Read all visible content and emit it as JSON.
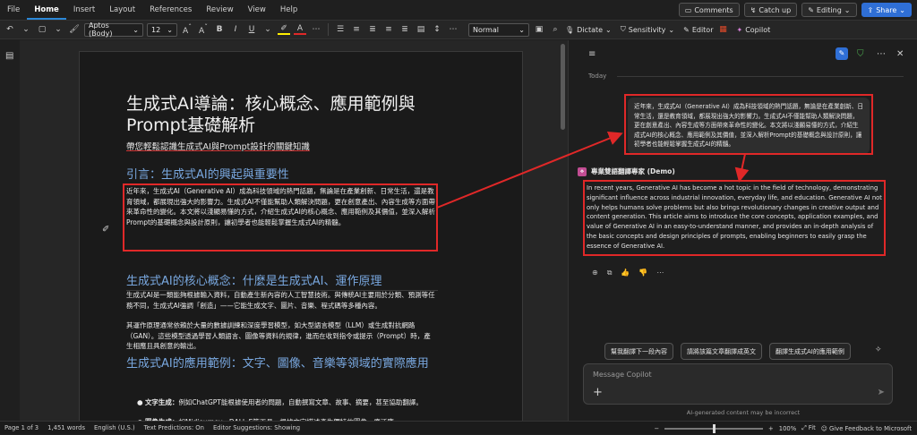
{
  "menu": {
    "items": [
      "File",
      "Home",
      "Insert",
      "Layout",
      "References",
      "Review",
      "View",
      "Help"
    ],
    "active": "Home",
    "comments": "Comments",
    "catch_up": "Catch up",
    "editing": "Editing",
    "share": "Share"
  },
  "ribbon": {
    "font": "Aptos (Body)",
    "size": "12",
    "style": "Normal",
    "dictate": "Dictate",
    "sensitivity": "Sensitivity",
    "editor": "Editor",
    "copilot": "Copilot"
  },
  "doc": {
    "title": "生成式AI導論：核心概念、應用範例與Prompt基礎解析",
    "subtitle": "帶您輕鬆認識生成式AI與Prompt設計的關鍵知識",
    "intro_heading": "引言：生成式AI的興起與重要性",
    "intro_para": "近年來，生成式AI（Generative AI）成為科技領域的熱門話題，無論是在產業創新、日常生活，還是教育領域，都展現出強大的影響力。生成式AI不僅能幫助人類解決問題，更在創意產出、內容生成等方面帶來革命性的變化。本文將以淺顯易懂的方式，介紹生成式AI的核心概念、應用範例及其價值，並深入解析Prompt的基礎概念與設計原則，讓初學者也能輕鬆掌握生成式AI的精髓。",
    "core_heading": "生成式AI的核心概念：什麼是生成式AI、運作原理",
    "core_para1": "生成式AI是一類能夠根據輸入資料，自動產生新內容的人工智慧技術。與傳統AI主要用於分類、預測等任務不同，生成式AI強調「創造」——它能生成文字、圖片、音樂、程式碼等多種內容。",
    "core_para2": "其運作原理通常依賴於大量的數據訓練和深度學習模型，如大型語言模型（LLM）或生成對抗網路（GAN）。這些模型透過學習人類語言、圖像等資料的規律，進而在收到指令或提示（Prompt）時，產生相應且具創意的輸出。",
    "app_heading": "生成式AI的應用範例：文字、圖像、音樂等領域的實際應用",
    "bullets": [
      {
        "label": "文字生成：",
        "text": "例如ChatGPT能根據使用者的問題，自動撰寫文章、故事、摘要，甚至協助翻譯。"
      },
      {
        "label": "圖像生成：",
        "text": "如Midjourney、DALL-E等工具，根據文字描述產生獨特的圖像，廣泛應"
      }
    ]
  },
  "copilot": {
    "today": "Today",
    "user_msg": "近年來，生成式AI（Generative AI）成為科技領域的熱門話題，無論是在產業創新、日常生活，還是教育領域，都展現出強大的影響力。生成式AI不僅能幫助人類解決問題，更在創意產出、內容生成等方面帶來革命性的變化。本文將以淺顯易懂的方式，介紹生成式AI的核心概念、應用範例及其價值，並深入解析Prompt的基礎概念與設計原則，讓初學者也能輕鬆掌握生成式AI的精髓。",
    "agent_name": "專業雙語翻譯專家 (Demo)",
    "agent_msg": "In recent years, Generative AI has become a hot topic in the field of technology, demonstrating significant influence across industrial innovation, everyday life, and education. Generative AI not only helps humans solve problems but also brings revolutionary changes in creative output and content generation. This article aims to introduce the core concepts, application examples, and value of Generative AI in an easy-to-understand manner, and provides an in-depth analysis of the basic concepts and design principles of prompts, enabling beginners to easily grasp the essence of Generative AI.",
    "suggestions": [
      "幫我翻譯下一段內容",
      "請將該篇文章翻譯成英文",
      "翻譯生成式AI的應用範例"
    ],
    "message_placeholder": "Message Copilot",
    "disclaimer": "AI-generated content may be incorrect"
  },
  "status": {
    "page": "Page 1 of 3",
    "words": "1,451 words",
    "language": "English (U.S.)",
    "predictions": "Text Predictions: On",
    "editor_suggestions": "Editor Suggestions: Showing",
    "zoom": "100%",
    "fit": "Fit",
    "feedback": "Give Feedback to Microsoft",
    "zoom_level": 1.0
  },
  "colors": {
    "accent": "#2b88d8",
    "heading": "#79a8e0",
    "highlight": "#e02828"
  }
}
